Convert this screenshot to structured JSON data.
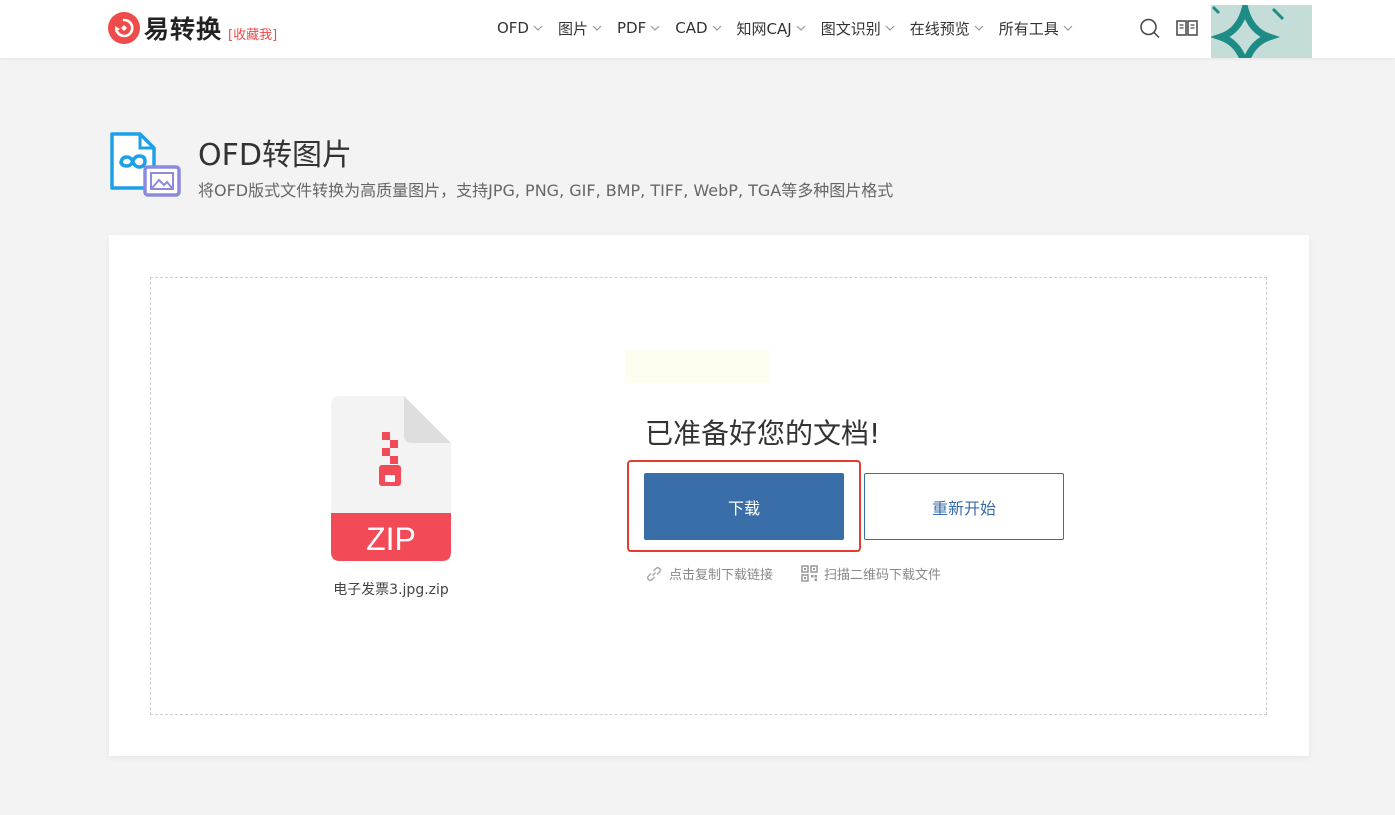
{
  "header": {
    "logo_text": "易转换",
    "favorite_label": "[收藏我]",
    "nav": [
      {
        "label": "OFD"
      },
      {
        "label": "图片"
      },
      {
        "label": "PDF"
      },
      {
        "label": "CAD"
      },
      {
        "label": "知网CAJ"
      },
      {
        "label": "图文识别"
      },
      {
        "label": "在线预览"
      },
      {
        "label": "所有工具"
      }
    ],
    "icons": [
      "search-icon",
      "book-icon"
    ]
  },
  "page": {
    "title": "OFD转图片",
    "subtitle": "将OFD版式文件转换为高质量图片，支持JPG, PNG, GIF, BMP, TIFF, WebP, TGA等多种图片格式"
  },
  "result": {
    "file_type_label": "ZIP",
    "file_name": "电子发票3.jpg.zip",
    "ready_text": "已准备好您的文档!",
    "download_label": "下载",
    "restart_label": "重新开始",
    "copy_link_label": "点击复制下载链接",
    "qr_label": "扫描二维码下载文件"
  },
  "colors": {
    "brand_red": "#ef4b4b",
    "primary_blue": "#3a6ea8",
    "highlight_red": "#e23d2e",
    "zip_band": "#f24b57"
  }
}
